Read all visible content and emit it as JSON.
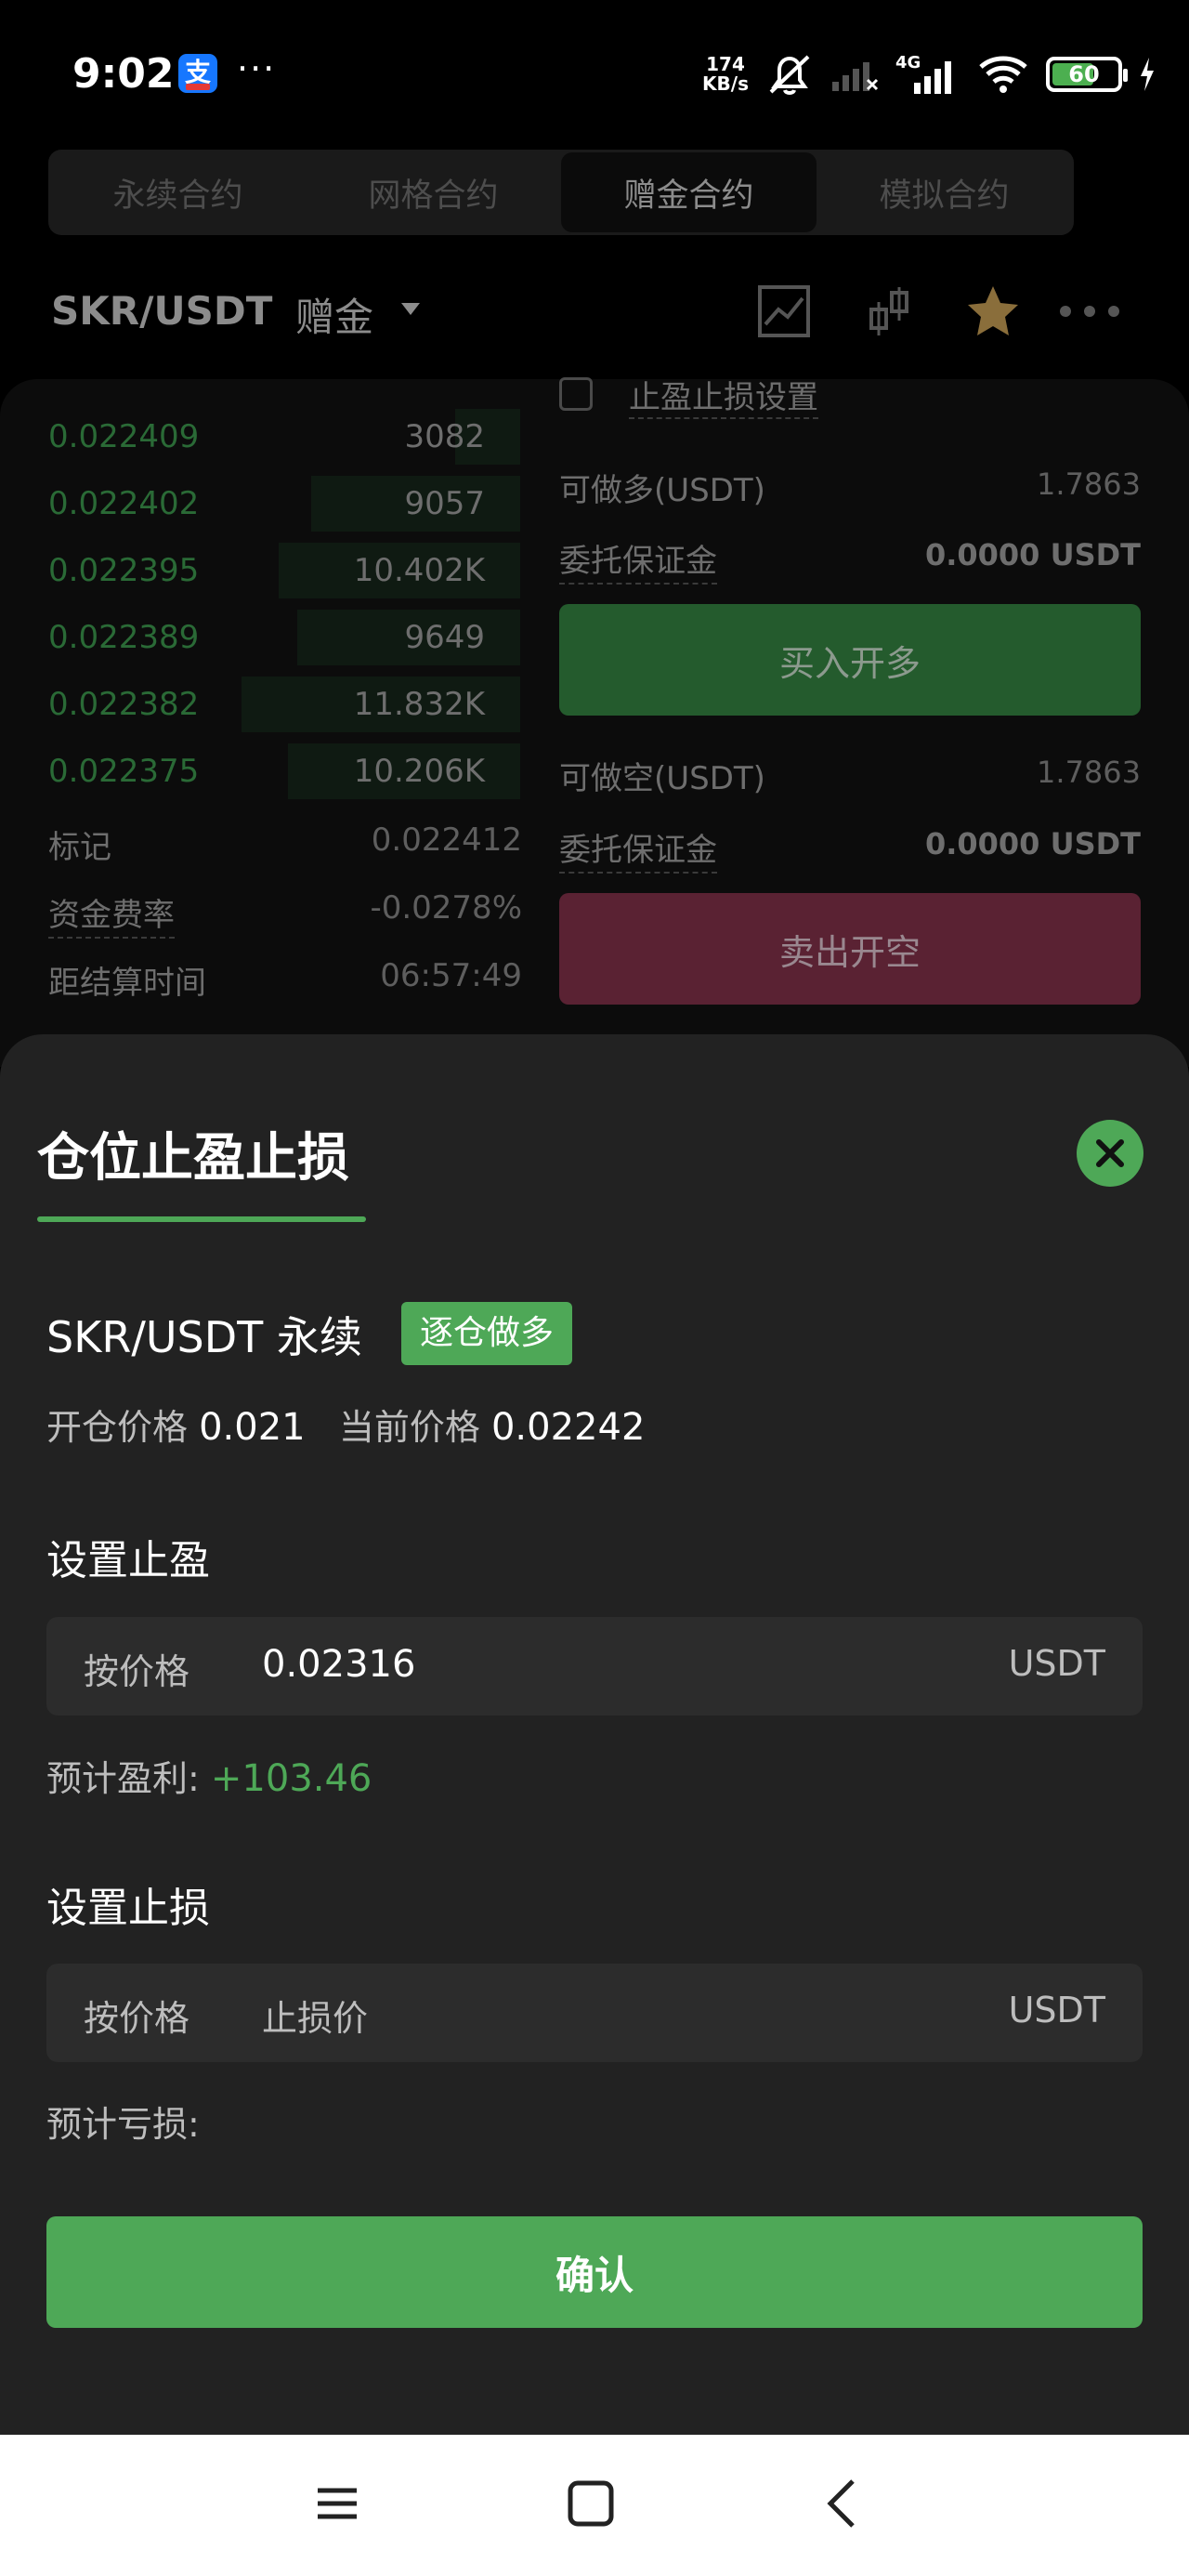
{
  "status_bar": {
    "time": "9:02",
    "app_icon": "支",
    "overflow": "···",
    "net_speed_value": "174",
    "net_speed_unit": "KB/s",
    "network": "4G",
    "battery": "60"
  },
  "tabs": [
    "永续合约",
    "网格合约",
    "赠金合约",
    "模拟合约"
  ],
  "active_tab": 2,
  "pair": {
    "symbol": "SKR/USDT",
    "type": "赠金"
  },
  "orderbook": [
    {
      "price": "0.022409",
      "qty": "3082",
      "depth": 0.14
    },
    {
      "price": "0.022402",
      "qty": "9057",
      "depth": 0.45
    },
    {
      "price": "0.022395",
      "qty": "10.402K",
      "depth": 0.52
    },
    {
      "price": "0.022389",
      "qty": "9649",
      "depth": 0.48
    },
    {
      "price": "0.022382",
      "qty": "11.832K",
      "depth": 0.6
    },
    {
      "price": "0.022375",
      "qty": "10.206K",
      "depth": 0.5
    }
  ],
  "market_info": {
    "mark_label": "标记",
    "mark_value": "0.022412",
    "funding_label": "资金费率",
    "funding_value": "-0.0278%",
    "settle_label": "距结算时间",
    "settle_value": "06:57:49"
  },
  "order_panel": {
    "tpsl_setting": "止盈止损设置",
    "long_avail_label": "可做多(USDT)",
    "long_avail_value": "1.7863",
    "long_margin_label": "委托保证金",
    "long_margin_value": "0.0000 USDT",
    "buy_label": "买入开多",
    "short_avail_label": "可做空(USDT)",
    "short_avail_value": "1.7863",
    "short_margin_label": "委托保证金",
    "short_margin_value": "0.0000 USDT",
    "sell_label": "卖出开空"
  },
  "sheet": {
    "title": "仓位止盈止损",
    "position_pair": "SKR/USDT 永续",
    "position_badge": "逐仓做多",
    "open_price_label": "开仓价格",
    "open_price": "0.021",
    "current_price_label": "当前价格",
    "current_price": "0.02242",
    "tp_title": "设置止盈",
    "tp_mode": "按价格",
    "tp_value": "0.02316",
    "tp_unit": "USDT",
    "tp_estimate_label": "预计盈利:",
    "tp_estimate_value": "+103.46",
    "sl_title": "设置止损",
    "sl_mode": "按价格",
    "sl_placeholder": "止损价",
    "sl_unit": "USDT",
    "sl_estimate_label": "预计亏损:",
    "confirm_label": "确认"
  },
  "colors": {
    "accent_green": "#4ea857",
    "sell_red": "#5a2233",
    "sheet_bg": "#222222"
  }
}
